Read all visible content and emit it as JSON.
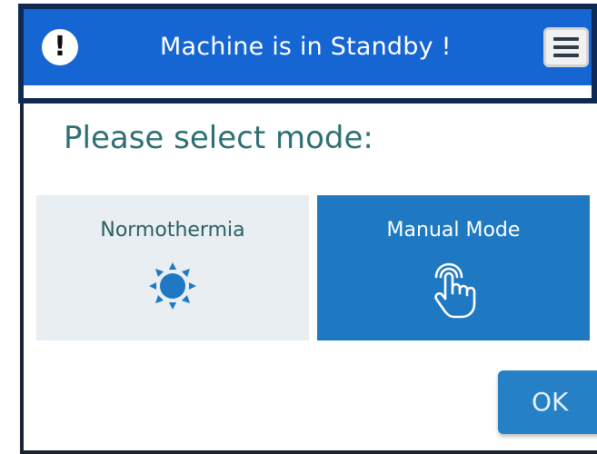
{
  "header": {
    "title": "Machine is in Standby !",
    "alert_icon": "exclamation-icon",
    "menu_icon": "hamburger-menu-icon",
    "colors": {
      "bar": "#1565d2",
      "frame": "#0f2a52"
    }
  },
  "prompt": {
    "text": "Please select mode:"
  },
  "modes": [
    {
      "label": "Normothermia",
      "icon": "sun-icon",
      "selected": false
    },
    {
      "label": "Manual Mode",
      "icon": "hand-pointer-icon",
      "selected": true
    }
  ],
  "ok_button": {
    "label": "OK"
  },
  "colors": {
    "accent": "#1e79c2",
    "prompt_text": "#2d6f73",
    "tile_inactive": "#e9eef2"
  }
}
